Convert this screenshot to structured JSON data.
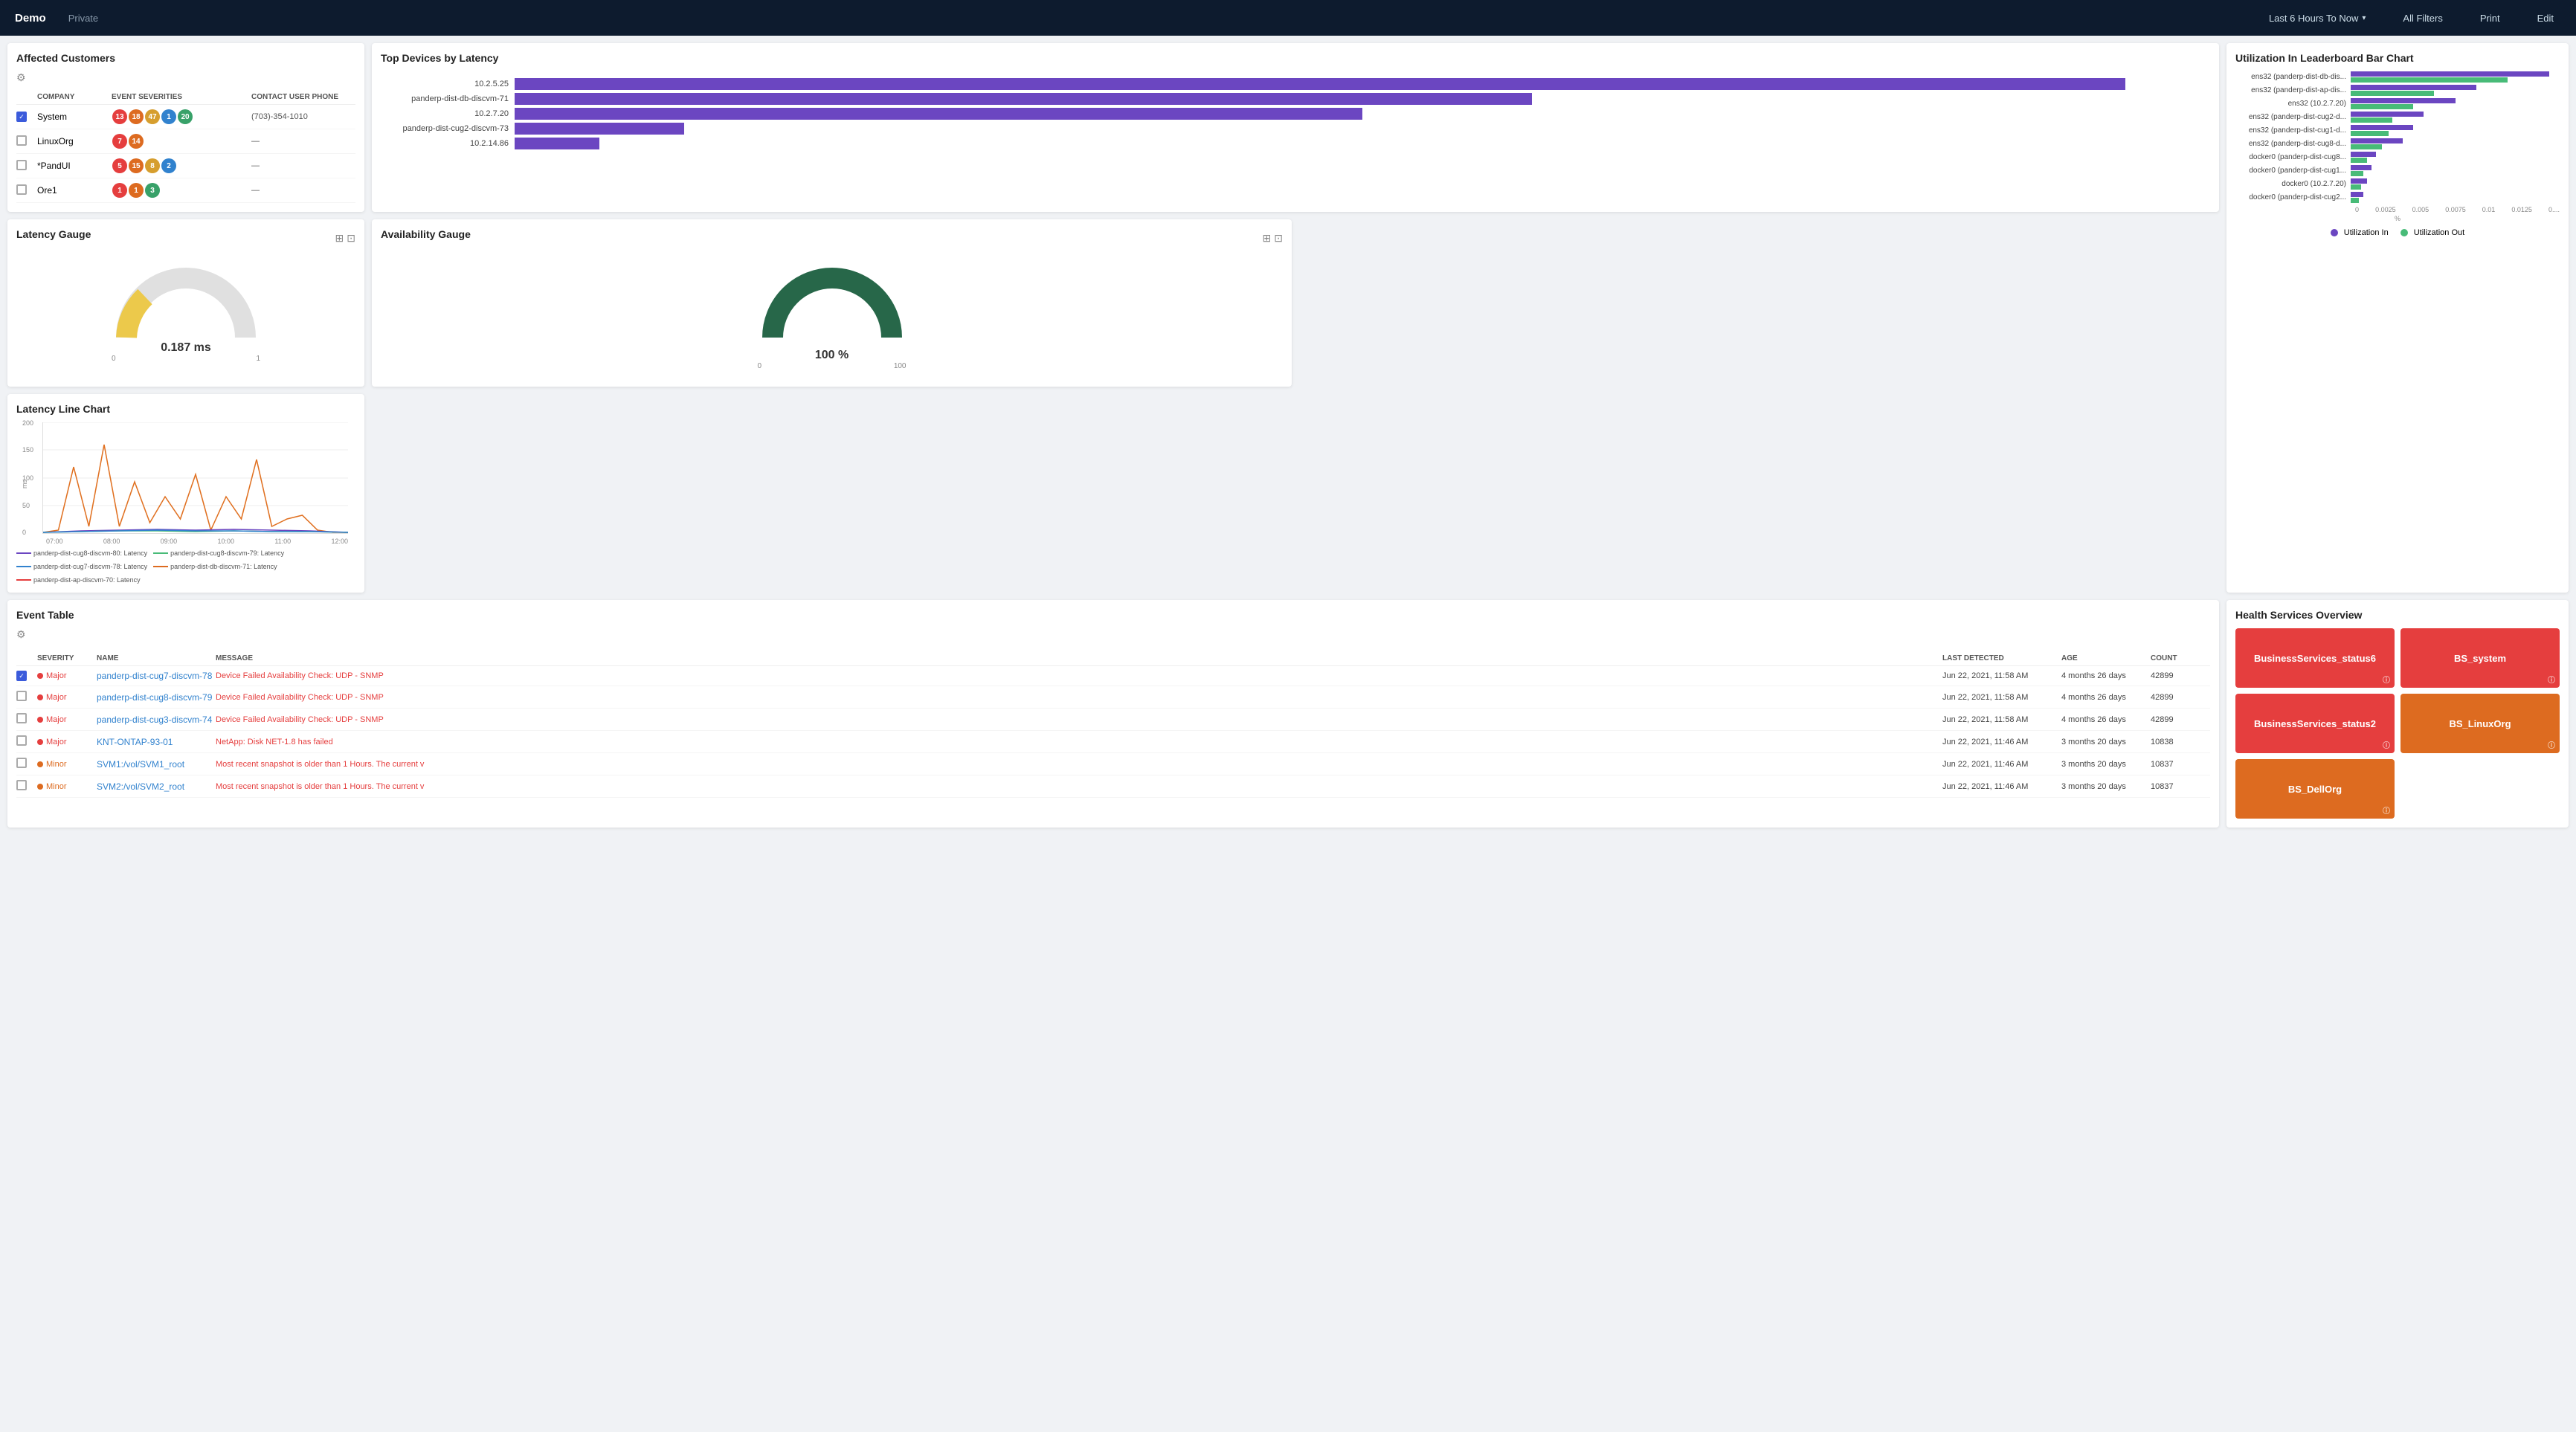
{
  "header": {
    "title": "Demo",
    "visibility": "Private",
    "time_filter": "Last 6 Hours To Now",
    "all_filters": "All Filters",
    "print": "Print",
    "edit": "Edit"
  },
  "affected_customers": {
    "title": "Affected Customers",
    "columns": [
      "",
      "COMPANY",
      "EVENT SEVERITIES",
      "CONTACT USER PHONE"
    ],
    "rows": [
      {
        "checked": true,
        "company": "System",
        "badges": [
          {
            "val": "13",
            "color": "red"
          },
          {
            "val": "18",
            "color": "orange"
          },
          {
            "val": "47",
            "color": "yellow"
          },
          {
            "val": "1",
            "color": "blue"
          },
          {
            "val": "20",
            "color": "green"
          }
        ],
        "phone": "(703)-354-1010"
      },
      {
        "checked": false,
        "company": "LinuxOrg",
        "badges": [
          {
            "val": "7",
            "color": "red"
          },
          {
            "val": "14",
            "color": "orange"
          }
        ],
        "phone": "—"
      },
      {
        "checked": false,
        "company": "*PandUI",
        "badges": [
          {
            "val": "5",
            "color": "red"
          },
          {
            "val": "15",
            "color": "orange"
          },
          {
            "val": "8",
            "color": "yellow"
          },
          {
            "val": "2",
            "color": "blue"
          }
        ],
        "phone": "—"
      },
      {
        "checked": false,
        "company": "Ore1",
        "badges": [
          {
            "val": "1",
            "color": "red"
          },
          {
            "val": "1",
            "color": "orange"
          },
          {
            "val": "3",
            "color": "green"
          }
        ],
        "phone": "—"
      }
    ]
  },
  "top_devices": {
    "title": "Top Devices by Latency",
    "bars": [
      {
        "label": "10.2.5.25",
        "value": 95,
        "max": 100
      },
      {
        "label": "panderp-dist-db-discvm-71",
        "value": 60,
        "max": 100
      },
      {
        "label": "10.2.7.20",
        "value": 50,
        "max": 100
      },
      {
        "label": "panderp-dist-cug2-discvm-73",
        "value": 10,
        "max": 100
      },
      {
        "label": "10.2.14.86",
        "value": 5,
        "max": 100
      }
    ]
  },
  "utilization": {
    "title": "Utilization In Leaderboard Bar Chart",
    "rows": [
      {
        "label": "ens32 (panderp-dist-db-dis...",
        "in": 95,
        "out": 75
      },
      {
        "label": "ens32 (panderp-dist-ap-dis...",
        "in": 60,
        "out": 40
      },
      {
        "label": "ens32 (10.2.7.20)",
        "in": 50,
        "out": 30
      },
      {
        "label": "ens32 (panderp-dist-cug2-d...",
        "in": 35,
        "out": 20
      },
      {
        "label": "ens32 (panderp-dist-cug1-d...",
        "in": 30,
        "out": 18
      },
      {
        "label": "ens32 (panderp-dist-cug8-d...",
        "in": 25,
        "out": 15
      },
      {
        "label": "docker0 (panderp-dist-cug8...",
        "in": 12,
        "out": 8
      },
      {
        "label": "docker0 (panderp-dist-cug1...",
        "in": 10,
        "out": 6
      },
      {
        "label": "docker0 (10.2.7.20)",
        "in": 8,
        "out": 5
      },
      {
        "label": "docker0 (panderp-dist-cug2...",
        "in": 6,
        "out": 4
      }
    ],
    "x_labels": [
      "0",
      "0.0025",
      "0.005",
      "0.0075",
      "0.01",
      "0.0125",
      "0...."
    ],
    "x_unit": "%",
    "legend_in": "Utilization In",
    "legend_out": "Utilization Out"
  },
  "latency_line": {
    "title": "Latency Line Chart",
    "y_label": "ms",
    "y_values": [
      "200",
      "150",
      "100",
      "50",
      "0"
    ],
    "x_values": [
      "07:00",
      "08:00",
      "09:00",
      "10:00",
      "11:00",
      "12:00"
    ],
    "legend": [
      {
        "label": "panderp-dist-cug8-discvm-80: Latency",
        "color": "#6b46c1"
      },
      {
        "label": "panderp-dist-cug8-discvm-79: Latency",
        "color": "#48bb78"
      },
      {
        "label": "panderp-dist-cug7-discvm-78: Latency",
        "color": "#3182ce"
      },
      {
        "label": "panderp-dist-db-discvm-71: Latency",
        "color": "#dd6b20"
      },
      {
        "label": "panderp-dist-ap-discvm-70: Latency",
        "color": "#e53e3e"
      }
    ]
  },
  "latency_gauge": {
    "title": "Latency Gauge",
    "value": "0.187 ms",
    "min": "0",
    "max": "1",
    "needle_pct": 0.187
  },
  "availability_gauge": {
    "title": "Availability Gauge",
    "value": "100 %",
    "min": "0",
    "max": "100",
    "pct": 1.0
  },
  "event_table": {
    "title": "Event Table",
    "columns": [
      "",
      "SEVERITY",
      "NAME",
      "MESSAGE",
      "LAST DETECTED",
      "AGE",
      "COUNT"
    ],
    "rows": [
      {
        "checked": true,
        "severity": "Major",
        "severity_color": "red",
        "name": "panderp-dist-cug7-discvm-78",
        "message": "Device Failed Availability Check: UDP - SNMP",
        "detected": "Jun 22, 2021, 11:58 AM",
        "age": "4 months 26 days",
        "count": "42899"
      },
      {
        "checked": false,
        "severity": "Major",
        "severity_color": "red",
        "name": "panderp-dist-cug8-discvm-79",
        "message": "Device Failed Availability Check: UDP - SNMP",
        "detected": "Jun 22, 2021, 11:58 AM",
        "age": "4 months 26 days",
        "count": "42899"
      },
      {
        "checked": false,
        "severity": "Major",
        "severity_color": "red",
        "name": "panderp-dist-cug3-discvm-74",
        "message": "Device Failed Availability Check: UDP - SNMP",
        "detected": "Jun 22, 2021, 11:58 AM",
        "age": "4 months 26 days",
        "count": "42899"
      },
      {
        "checked": false,
        "severity": "Major",
        "severity_color": "red",
        "name": "KNT-ONTAP-93-01",
        "message": "NetApp: Disk NET-1.8 has failed",
        "detected": "Jun 22, 2021, 11:46 AM",
        "age": "3 months 20 days",
        "count": "10838"
      },
      {
        "checked": false,
        "severity": "Minor",
        "severity_color": "orange",
        "name": "SVM1:/vol/SVM1_root",
        "message": "Most recent snapshot is older than 1 Hours. The current v",
        "detected": "Jun 22, 2021, 11:46 AM",
        "age": "3 months 20 days",
        "count": "10837"
      },
      {
        "checked": false,
        "severity": "Minor",
        "severity_color": "orange",
        "name": "SVM2:/vol/SVM2_root",
        "message": "Most recent snapshot is older than 1 Hours. The current v",
        "detected": "Jun 22, 2021, 11:46 AM",
        "age": "3 months 20 days",
        "count": "10837"
      }
    ]
  },
  "health_services": {
    "title": "Health Services Overview",
    "cards": [
      {
        "label": "BusinessServices_status6",
        "color": "red"
      },
      {
        "label": "BS_system",
        "color": "red"
      },
      {
        "label": "BusinessServices_status2",
        "color": "red"
      },
      {
        "label": "BS_LinuxOrg",
        "color": "orange"
      },
      {
        "label": "BS_DellOrg",
        "color": "orange"
      }
    ]
  }
}
